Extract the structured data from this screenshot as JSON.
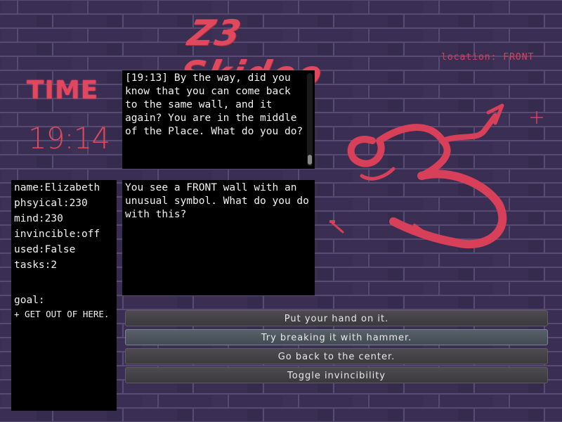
{
  "game": {
    "title": "Z3 Skidoo",
    "location_label": "location:",
    "location_value": "FRONT",
    "time_label": "TIME",
    "time_value": "19:14"
  },
  "log": {
    "text": "[19:13] By the way, did you know that you can come back to the same wall, and it again? You are in the middle of the Place. What do you do?"
  },
  "description": {
    "text": "You see a FRONT wall with an unusual symbol. What do you do with this?"
  },
  "stats": {
    "name": "name:Elizabeth",
    "physical": "phsyical:230",
    "mind": "mind:230",
    "invincible": "invincible:off",
    "used": "used:False",
    "tasks": "tasks:2",
    "goal_label": "goal:",
    "goal_item": "+ GET OUT OF HERE."
  },
  "actions": [
    {
      "label": "Put your hand on it."
    },
    {
      "label": "Try breaking it with hammer."
    },
    {
      "label": "Go back to the center."
    },
    {
      "label": "Toggle invincibility"
    }
  ],
  "colors": {
    "accent": "#e0485e",
    "wall": "#3a2e52",
    "panel": "#000000"
  },
  "icons": {
    "wall_symbol": "graffiti-3-symbol",
    "hammer": "hammer-icon",
    "crosshair": "crosshair-icon"
  }
}
